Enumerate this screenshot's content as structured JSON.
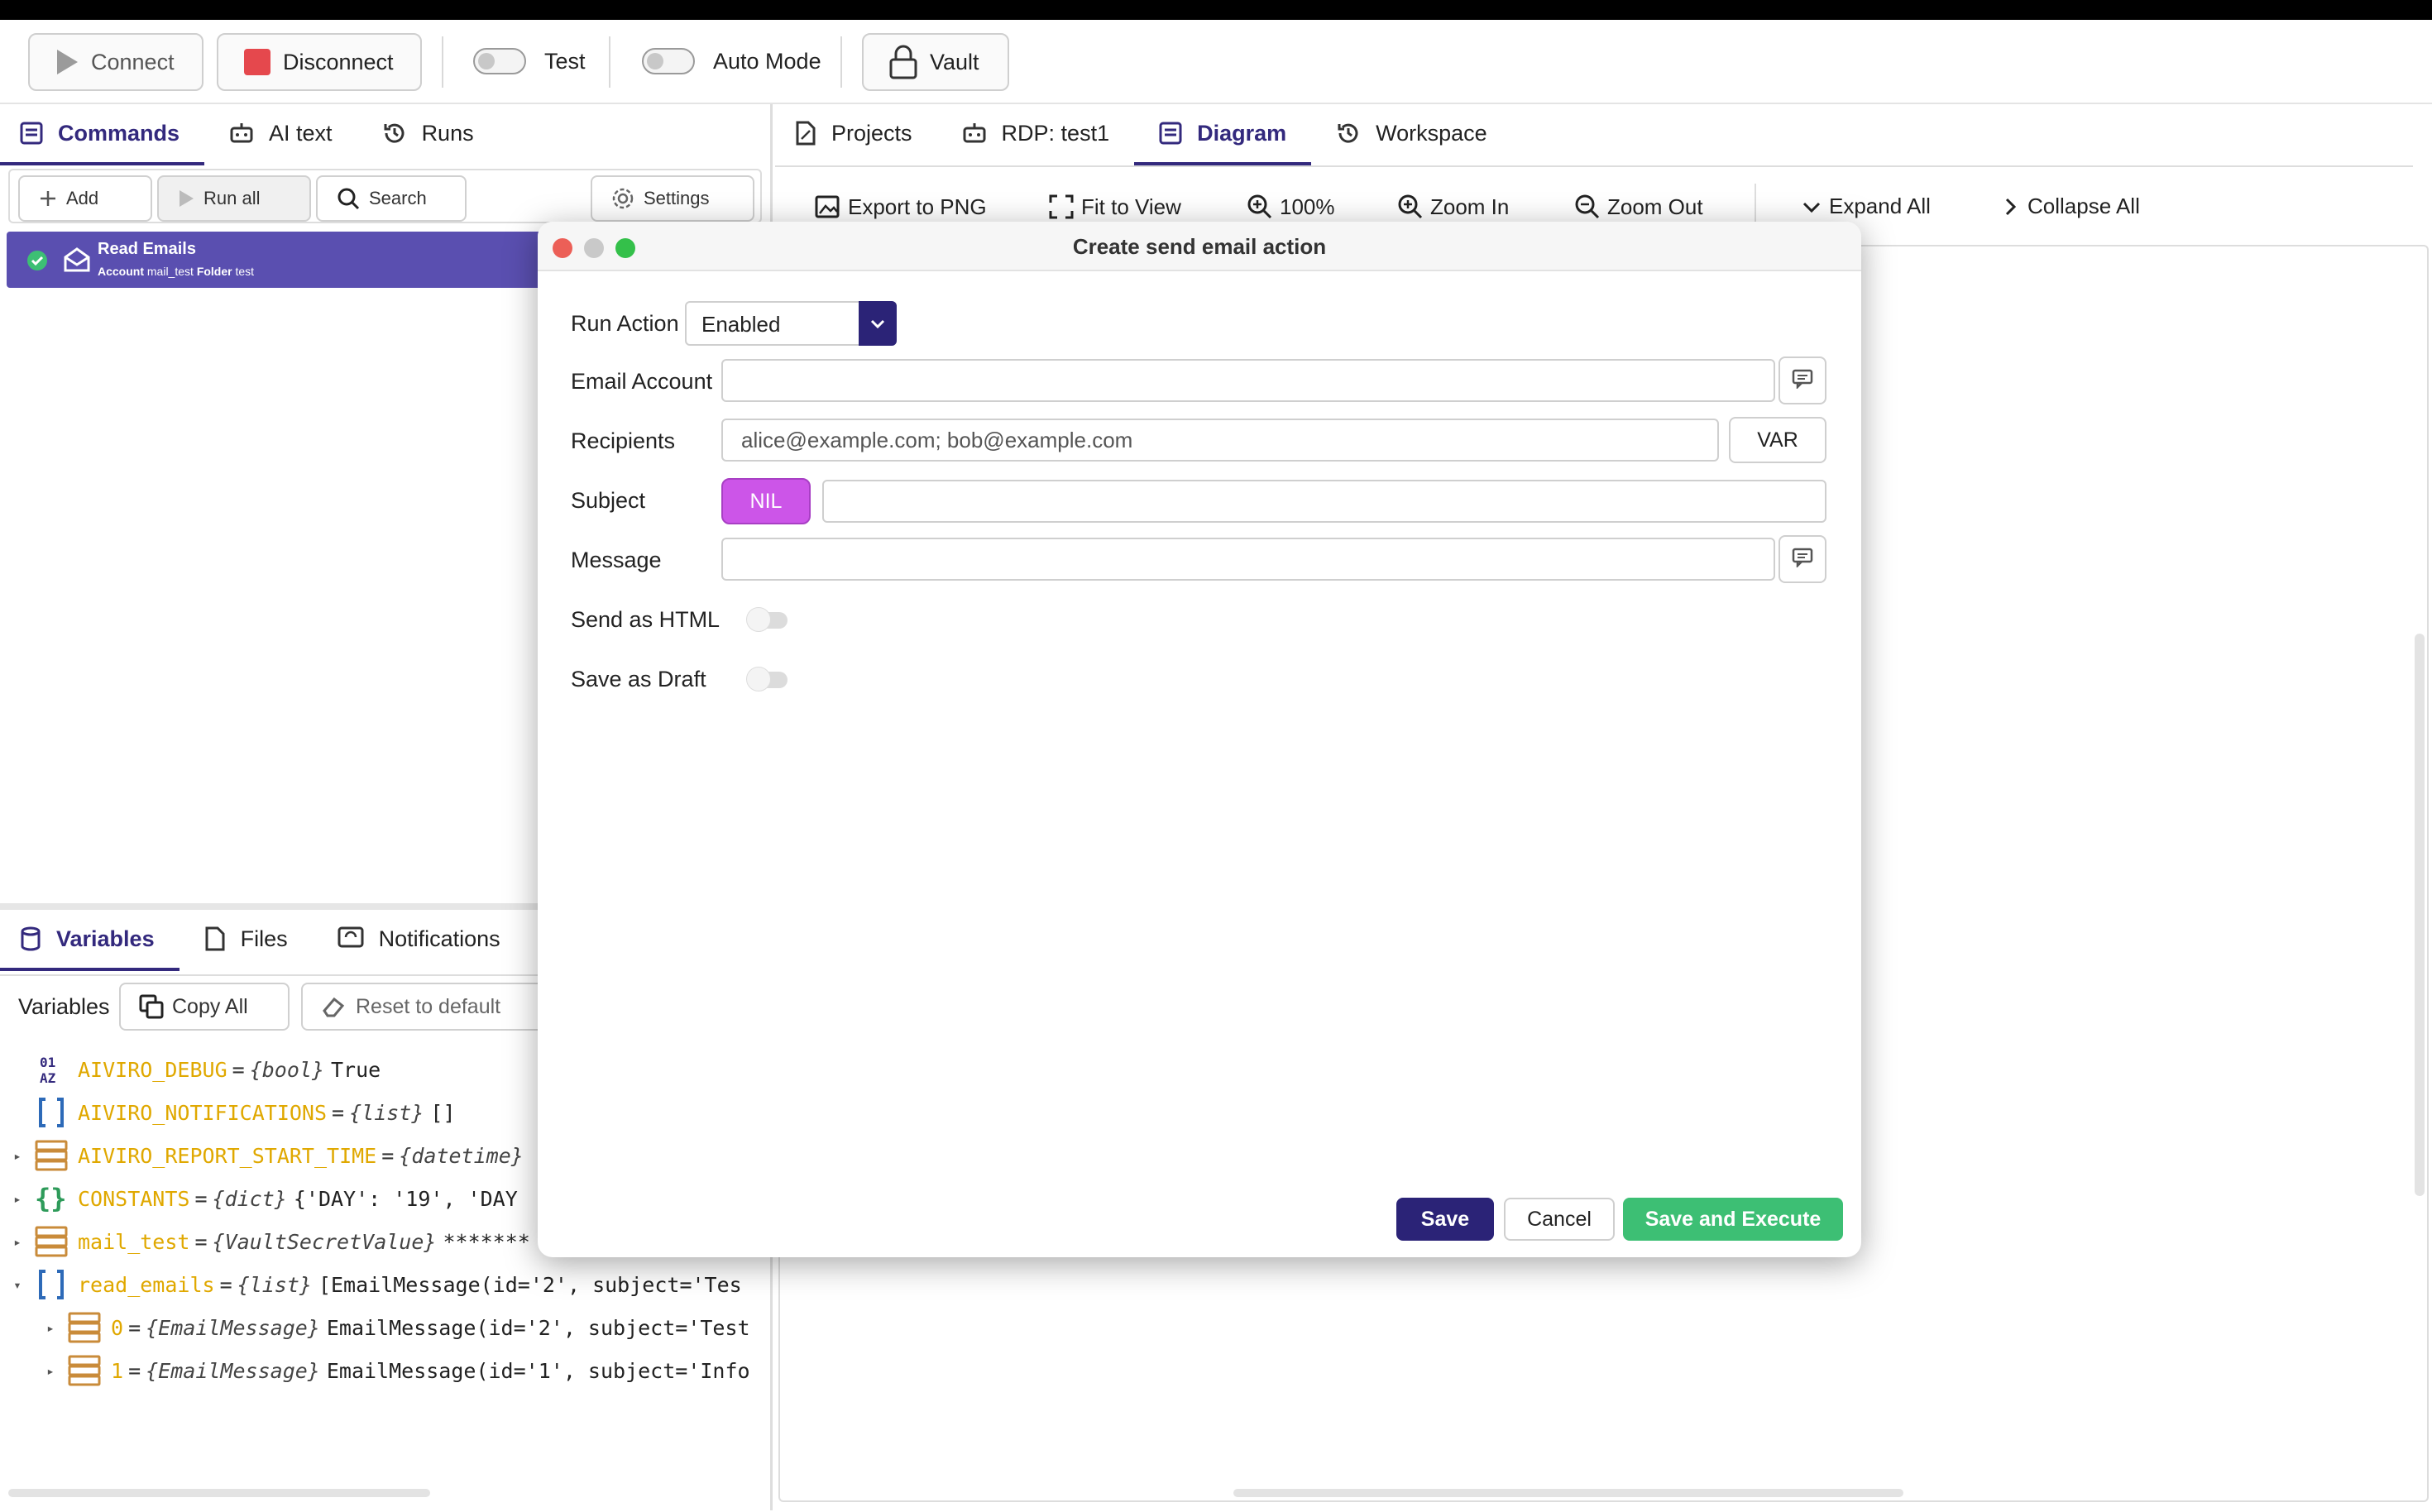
{
  "toolbar": {
    "connect": "Connect",
    "disconnect": "Disconnect",
    "test": "Test",
    "auto_mode": "Auto Mode",
    "vault": "Vault"
  },
  "left_tabs": [
    {
      "label": "Commands",
      "icon": "commands-icon",
      "active": true
    },
    {
      "label": "AI text",
      "icon": "robot-icon",
      "active": false
    },
    {
      "label": "Runs",
      "icon": "history-icon",
      "active": false
    }
  ],
  "commands_toolbar": {
    "add": "Add",
    "run_all": "Run all",
    "search": "Search",
    "settings": "Settings"
  },
  "commands": [
    {
      "title": "Read Emails",
      "account_label": "Account",
      "account_value": "mail_test",
      "folder_label": "Folder",
      "folder_value": "test",
      "status": "success"
    }
  ],
  "bottom_tabs": [
    {
      "label": "Variables",
      "icon": "database-icon",
      "active": true
    },
    {
      "label": "Files",
      "icon": "file-icon",
      "active": false
    },
    {
      "label": "Notifications",
      "icon": "notification-icon",
      "active": false
    }
  ],
  "variables_toolbar": {
    "label": "Variables",
    "copy_all": "Copy All",
    "reset": "Reset to default"
  },
  "variables": [
    {
      "name": "AIVIRO_DEBUG",
      "type": "{bool}",
      "value": "True",
      "icon": "bool-icon",
      "indent": 0,
      "expander": ""
    },
    {
      "name": "AIVIRO_NOTIFICATIONS",
      "type": "{list}",
      "value": "[]",
      "icon": "list-icon",
      "indent": 0,
      "expander": ""
    },
    {
      "name": "AIVIRO_REPORT_START_TIME",
      "type": "{datetime}",
      "value": "",
      "icon": "object-icon",
      "indent": 0,
      "expander": "▸"
    },
    {
      "name": "CONSTANTS",
      "type": "{dict}",
      "value": "{'DAY': '19', 'DAY",
      "icon": "dict-icon",
      "indent": 0,
      "expander": "▸"
    },
    {
      "name": "mail_test",
      "type": "{VaultSecretValue}",
      "value": "*******",
      "icon": "object-icon",
      "indent": 0,
      "expander": "▸"
    },
    {
      "name": "read_emails",
      "type": "{list}",
      "value": "[EmailMessage(id='2', subject='Tes",
      "icon": "list-icon",
      "indent": 0,
      "expander": "▾"
    },
    {
      "name": "0",
      "type": "{EmailMessage}",
      "value": "EmailMessage(id='2', subject='Test",
      "icon": "object-icon",
      "indent": 1,
      "expander": "▸"
    },
    {
      "name": "1",
      "type": "{EmailMessage}",
      "value": "EmailMessage(id='1', subject='Info",
      "icon": "object-icon",
      "indent": 1,
      "expander": "▸"
    }
  ],
  "right_tabs": [
    {
      "label": "Projects",
      "icon": "projects-icon",
      "active": false
    },
    {
      "label": "RDP: test1",
      "icon": "robot-icon",
      "active": false
    },
    {
      "label": "Diagram",
      "icon": "diagram-icon",
      "active": true
    },
    {
      "label": "Workspace",
      "icon": "history-icon",
      "active": false
    }
  ],
  "diagram_toolbar": {
    "export": "Export to PNG",
    "fit": "Fit to View",
    "zoom": "100%",
    "zoom_in": "Zoom In",
    "zoom_out": "Zoom Out",
    "expand": "Expand All",
    "collapse": "Collapse All"
  },
  "modal": {
    "title": "Create send email action",
    "run_action_label": "Run Action",
    "run_action_value": "Enabled",
    "email_account_label": "Email Account",
    "email_account_value": "",
    "recipients_label": "Recipients",
    "recipients_placeholder": "alice@example.com; bob@example.com",
    "var_button": "VAR",
    "subject_label": "Subject",
    "nil_button": "NIL",
    "subject_value": "",
    "message_label": "Message",
    "message_value": "",
    "send_html_label": "Send as HTML",
    "save_draft_label": "Save as Draft",
    "save": "Save",
    "cancel": "Cancel",
    "save_execute": "Save and Execute"
  },
  "colors": {
    "accent": "#33297d",
    "selected_row": "#5a4fb0",
    "nil": "#cc55e8",
    "success": "#3dbf74",
    "disconnect": "#e5484d",
    "variable_name": "#e0a800"
  }
}
